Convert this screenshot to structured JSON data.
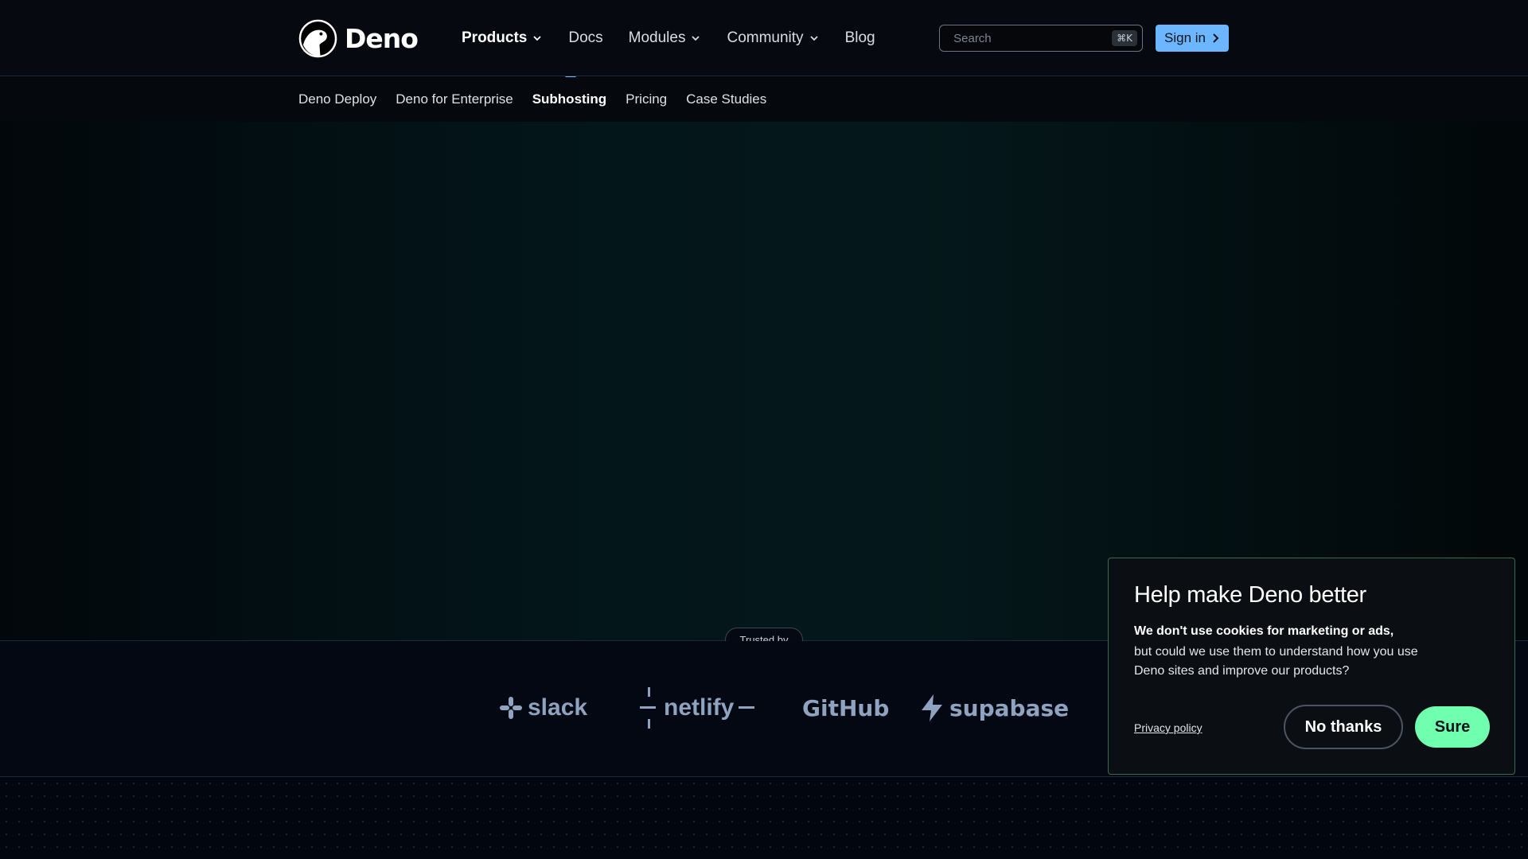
{
  "brand": {
    "name": "Deno"
  },
  "nav": {
    "items": [
      {
        "label": "Products",
        "dropdown": true
      },
      {
        "label": "Docs",
        "dropdown": false
      },
      {
        "label": "Modules",
        "dropdown": true
      },
      {
        "label": "Community",
        "dropdown": true
      },
      {
        "label": "Blog",
        "dropdown": false
      }
    ],
    "search": {
      "placeholder": "Search",
      "shortcut": "⌘K"
    },
    "signin_label": "Sign in"
  },
  "subnav": {
    "items": [
      {
        "label": "Deno Deploy"
      },
      {
        "label": "Deno for Enterprise"
      },
      {
        "label": "Subhosting",
        "active": true
      },
      {
        "label": "Pricing"
      },
      {
        "label": "Case Studies"
      }
    ]
  },
  "trusted": {
    "label": "Trusted by",
    "logos": [
      "slack",
      "netlify",
      "GitHub",
      "supabase"
    ]
  },
  "cookie": {
    "title": "Help make Deno better",
    "lead": "We don't use cookies for marketing or ads,",
    "body": "but could we use them to understand how you use Deno sites and improve our products?",
    "privacy_label": "Privacy policy",
    "decline_label": "No thanks",
    "accept_label": "Sure"
  },
  "colors": {
    "accent": "#6cb6ff",
    "accept": "#70ffaf",
    "logo_gray": "#8fa2bf"
  }
}
